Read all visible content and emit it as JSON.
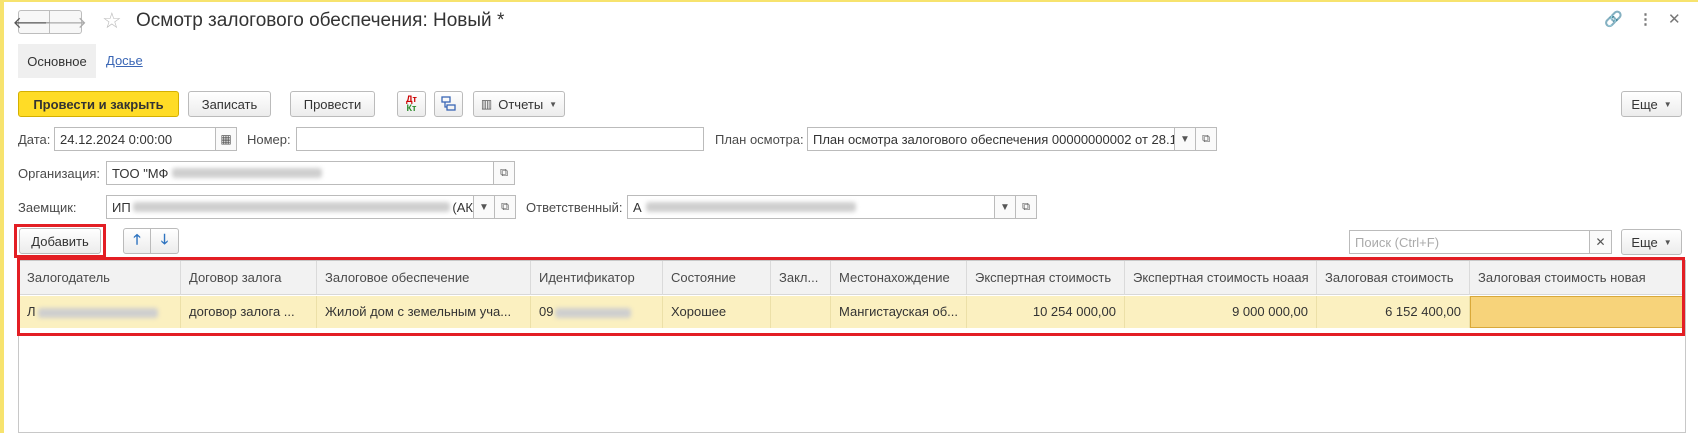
{
  "window": {
    "title": "Осмотр залогового обеспечения: Новый *"
  },
  "tabs": {
    "main": "Основное",
    "dossier": "Досье"
  },
  "toolbar": {
    "post_and_close": "Провести и закрыть",
    "save": "Записать",
    "post": "Провести",
    "dt_kt_icon": "Дт\nКт",
    "reports": "Отчеты",
    "more": "Еще"
  },
  "form": {
    "date_label": "Дата:",
    "date_value": "24.12.2024  0:00:00",
    "number_label": "Номер:",
    "number_value": "",
    "plan_label": "План осмотра:",
    "plan_value": "План осмотра залогового обеспечения 00000000002 от 28.1",
    "org_label": "Организация:",
    "org_value": "ТОО \"МФ",
    "borrower_label": "Заемщик:",
    "borrower_value_prefix": "ИП",
    "borrower_value_suffix": "(АК",
    "responsible_label": "Ответственный:",
    "responsible_value": "А"
  },
  "table_toolbar": {
    "add": "Добавить",
    "search_placeholder": "Поиск (Ctrl+F)",
    "more": "Еще"
  },
  "table": {
    "columns": [
      "Залогодатель",
      "Договор залога",
      "Залоговое обеспечение",
      "Идентификатор",
      "Состояние",
      "Закл...",
      "Местонахождение",
      "Экспертная стоимость",
      "Экспертная стоимость ноаая",
      "Залоговая стоимость",
      "Залоговая стоимость новая"
    ],
    "rows": [
      {
        "pledger": "Л",
        "contract": "договор залога ...",
        "collateral": "Жилой дом с земельным уча...",
        "identifier": "09",
        "condition": "Хорошее",
        "conclusion": "",
        "location": "Мангистауская об...",
        "expert_value": "10 254 000,00",
        "expert_value_new": "9 000 000,00",
        "pledge_value": "6 152 400,00",
        "pledge_value_new": ""
      }
    ]
  },
  "colors": {
    "accent_yellow": "#ffdc26",
    "highlight_red": "#e31e24",
    "selected_row": "#fbf0c0",
    "link_blue": "#3a66b5"
  }
}
